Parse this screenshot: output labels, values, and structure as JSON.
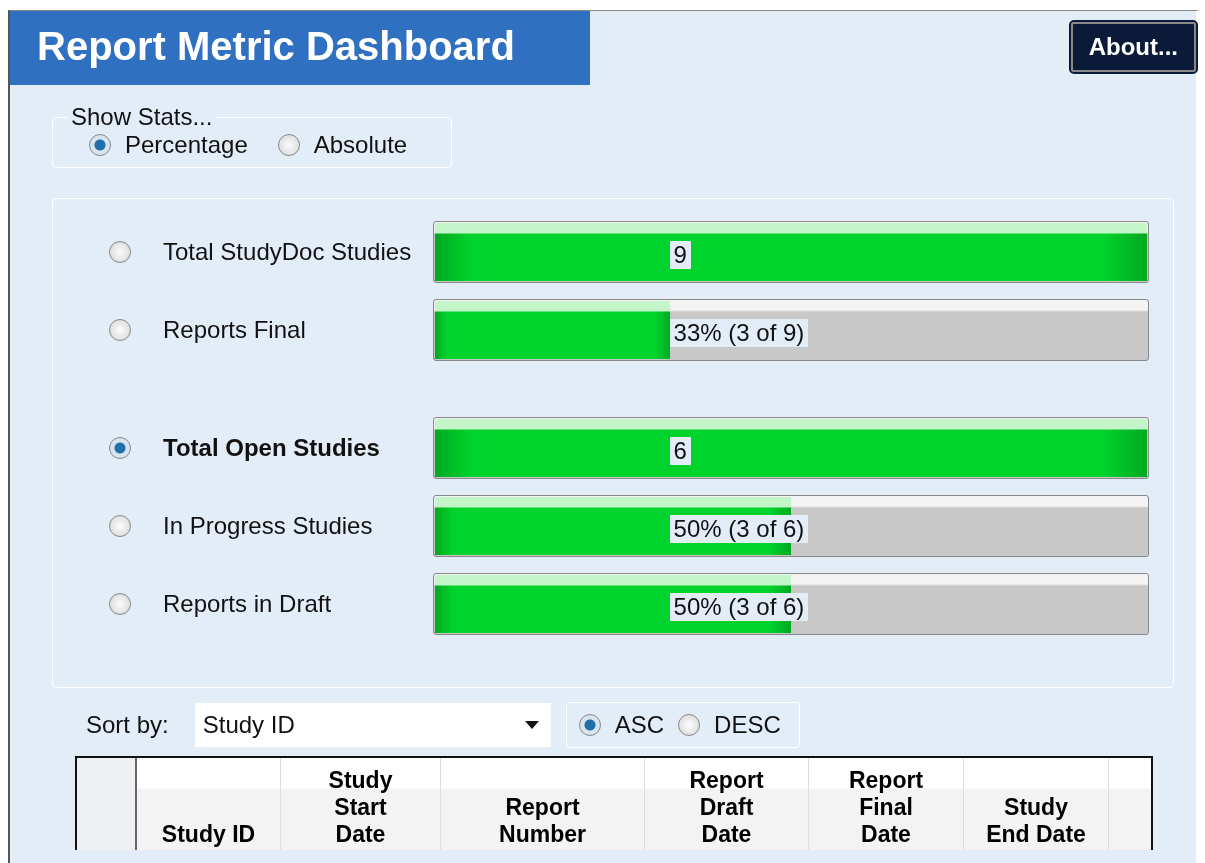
{
  "window": {
    "title": "Report Metric Dashboard",
    "about_button": "About..."
  },
  "show_stats": {
    "legend": "Show Stats...",
    "options": [
      {
        "label": "Percentage",
        "selected": true
      },
      {
        "label": "Absolute",
        "selected": false
      }
    ]
  },
  "metric_groups": [
    {
      "metrics": [
        {
          "label": "Total StudyDoc Studies",
          "selected": false,
          "level": 1,
          "reading": "9"
        },
        {
          "label": "Reports Final",
          "selected": false,
          "level": 0.33,
          "reading": "33% (3 of 9)"
        }
      ]
    },
    {
      "metrics": [
        {
          "label": "Total Open Studies",
          "selected": true,
          "level": 1,
          "reading": "6"
        },
        {
          "label": "In Progress Studies",
          "selected": false,
          "level": 0.5,
          "reading": "50% (3 of 6)"
        },
        {
          "label": "Reports in Draft",
          "selected": false,
          "level": 0.5,
          "reading": "50% (3 of 6)"
        }
      ]
    }
  ],
  "sort": {
    "label": "Sort by:",
    "value": "Study ID",
    "order": [
      {
        "label": "ASC",
        "selected": true
      },
      {
        "label": "DESC",
        "selected": false
      }
    ]
  },
  "table": {
    "columns": [
      "Study ID",
      "Study Start Date",
      "Report Number",
      "Report Draft Date",
      "Report Final Date",
      "Study End Date"
    ]
  }
}
